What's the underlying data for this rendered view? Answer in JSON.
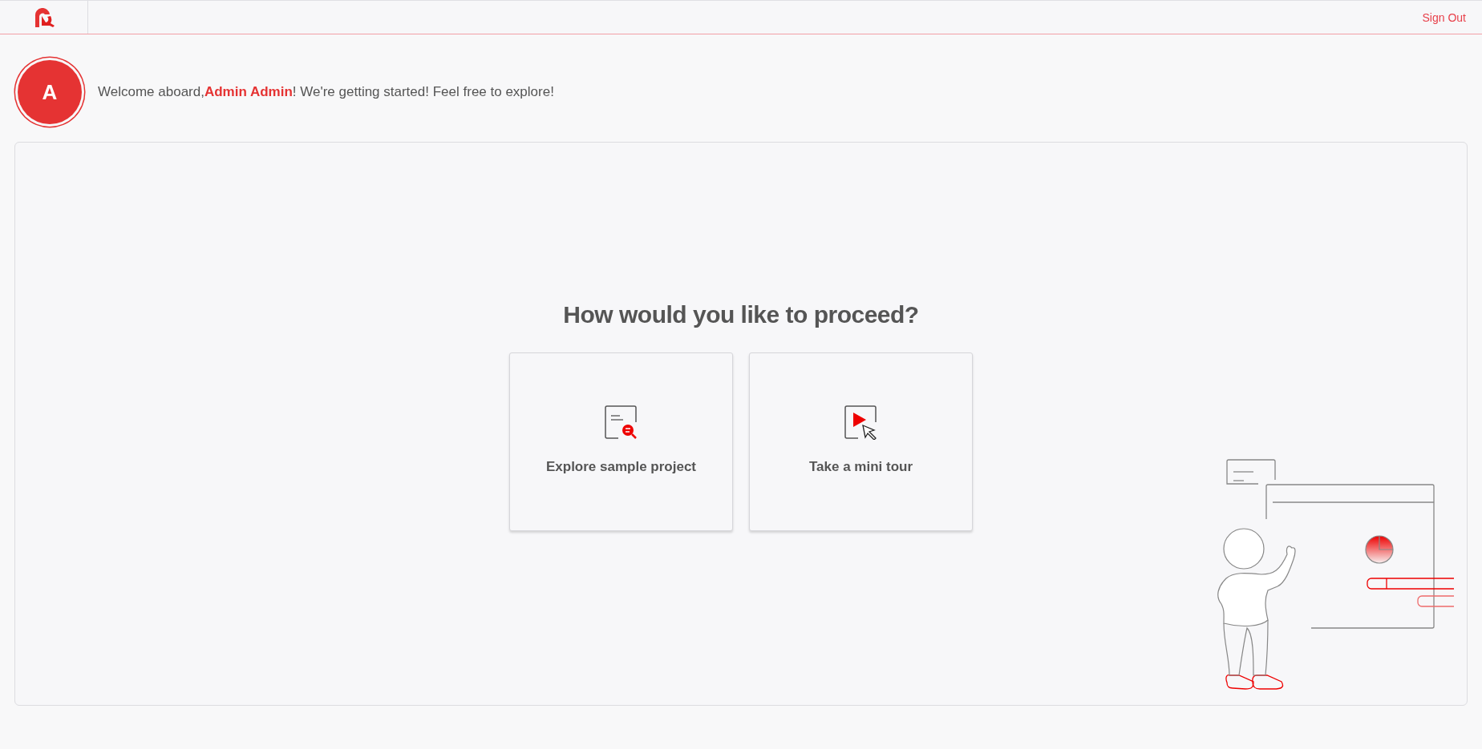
{
  "header": {
    "sign_out": "Sign Out"
  },
  "welcome": {
    "avatar_initial": "A",
    "message": "Welcome aboard,**Admin Admin**! We're getting started! Feel free to explore!"
  },
  "main": {
    "title": "How would you like to proceed?",
    "options": [
      {
        "kind": "explore",
        "label": "Explore sample project"
      },
      {
        "kind": "tour",
        "label": "Take a mini tour"
      }
    ]
  }
}
